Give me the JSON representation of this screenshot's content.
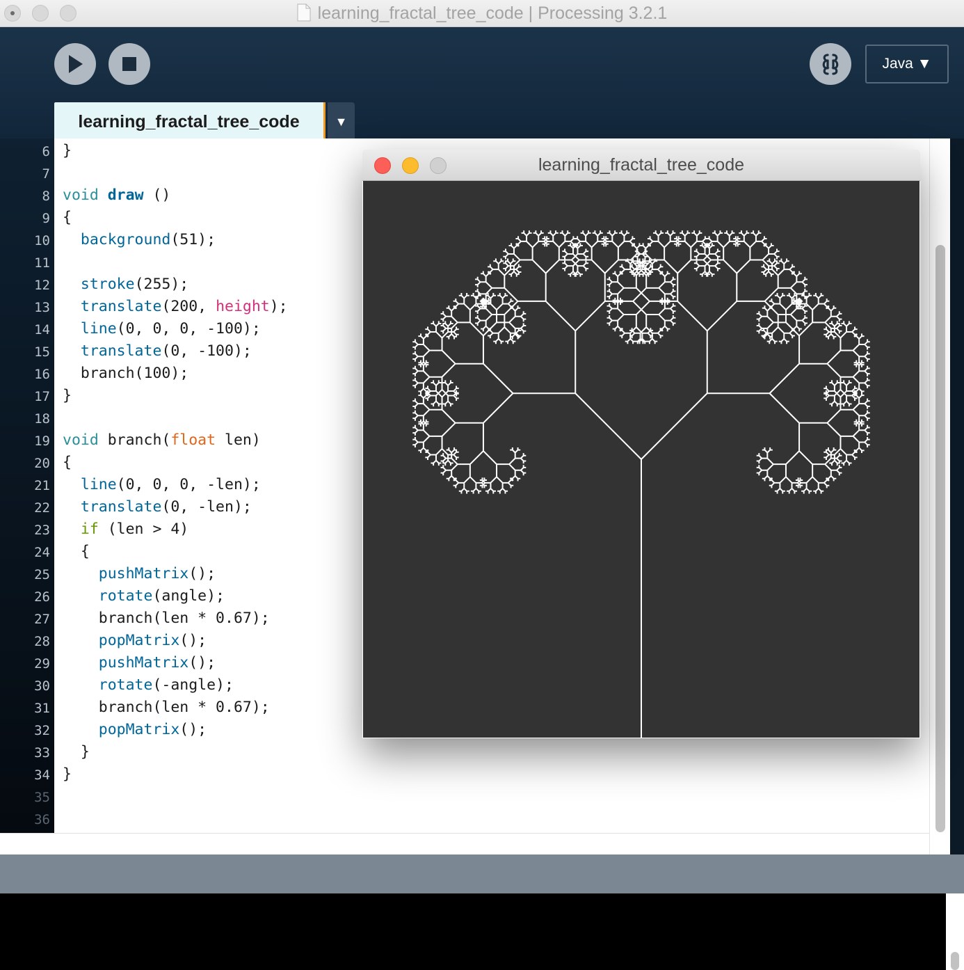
{
  "window": {
    "title": "learning_fractal_tree_code | Processing 3.2.1"
  },
  "toolbar": {
    "run_icon": "play-icon",
    "stop_icon": "stop-icon",
    "mode_icon": "debugger-icon",
    "mode_label": "Java ▼"
  },
  "tabs": [
    {
      "label": "learning_fractal_tree_code"
    }
  ],
  "tab_menu": "▼",
  "editor": {
    "line_numbers": [
      "6",
      "7",
      "8",
      "9",
      "10",
      "11",
      "12",
      "13",
      "14",
      "15",
      "16",
      "17",
      "18",
      "19",
      "20",
      "21",
      "22",
      "23",
      "24",
      "25",
      "26",
      "27",
      "28",
      "29",
      "30",
      "31",
      "32",
      "33",
      "34",
      "35",
      "36"
    ]
  },
  "sketch": {
    "title": "learning_fractal_tree_code",
    "background": "#333333",
    "stroke": "#ffffff",
    "trunk_length": 100,
    "scale": 0.67,
    "min_len": 4
  },
  "colors": {
    "accent_tab": "#f39a1e",
    "header": "#1b3349",
    "keyword_void": "#2a8f9a",
    "builtin": "#006699",
    "type_float": "#e2661a",
    "var_height": "#d4307a",
    "keyword_if": "#669900"
  }
}
